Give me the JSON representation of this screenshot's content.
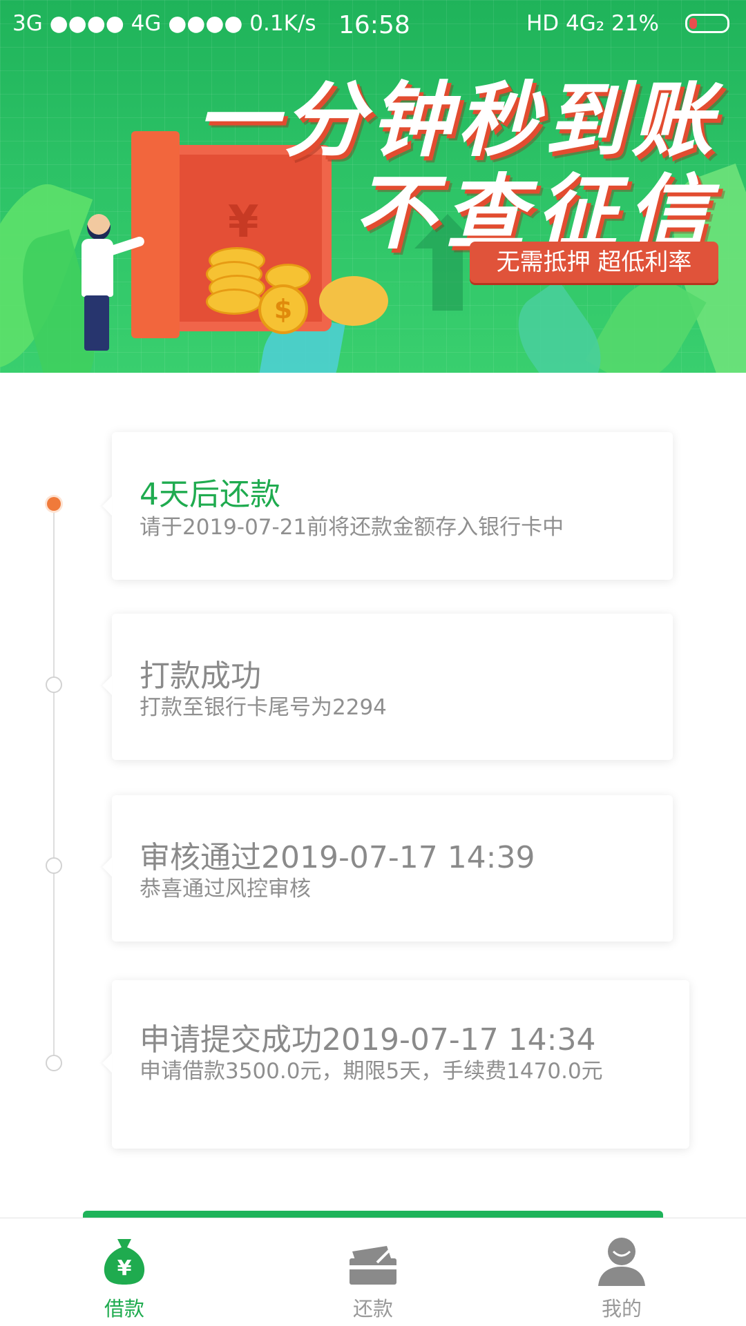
{
  "status_bar": {
    "left": "3G ●●●● 4G ●●●● 0.1K/s",
    "time": "16:58",
    "right": "HD 4G₂ 21%",
    "battery_level": 0.21
  },
  "banner": {
    "headline_1": "一分钟秒到账",
    "headline_2": "不查征信",
    "tagline": "无需抵押 超低利率",
    "safe_symbol": "¥",
    "coin_symbol": "$"
  },
  "timeline": [
    {
      "title": "4天后还款",
      "desc": "请于2019-07-21前将还款金额存入银行卡中",
      "active": true
    },
    {
      "title": "打款成功",
      "desc": "打款至银行卡尾号为2294",
      "active": false
    },
    {
      "title": "审核通过2019-07-17 14:39",
      "desc": "恭喜通过风控审核",
      "active": false
    },
    {
      "title": "申请提交成功2019-07-17 14:34",
      "desc": "申请借款3500.0元，期限5天，手续费1470.0元",
      "active": false
    }
  ],
  "tabs": [
    {
      "label": "借款",
      "icon": "money-bag-icon",
      "active": true
    },
    {
      "label": "还款",
      "icon": "card-icon",
      "active": false
    },
    {
      "label": "我的",
      "icon": "user-icon",
      "active": false
    }
  ],
  "colors": {
    "brand_green": "#1fab4f",
    "accent_orange": "#f07a3a",
    "tag_red": "#e0533a"
  }
}
